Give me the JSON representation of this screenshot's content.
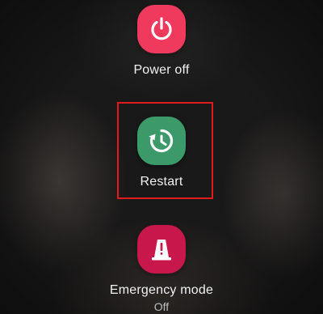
{
  "options": {
    "power_off": {
      "label": "Power off",
      "icon": "power-icon",
      "color": "#ef3a5d"
    },
    "restart": {
      "label": "Restart",
      "icon": "restart-icon",
      "color": "#3c9a6a"
    },
    "emergency": {
      "label": "Emergency mode",
      "status": "Off",
      "icon": "emergency-icon",
      "color": "#c8174a"
    }
  },
  "highlight_color": "#e11b1b"
}
